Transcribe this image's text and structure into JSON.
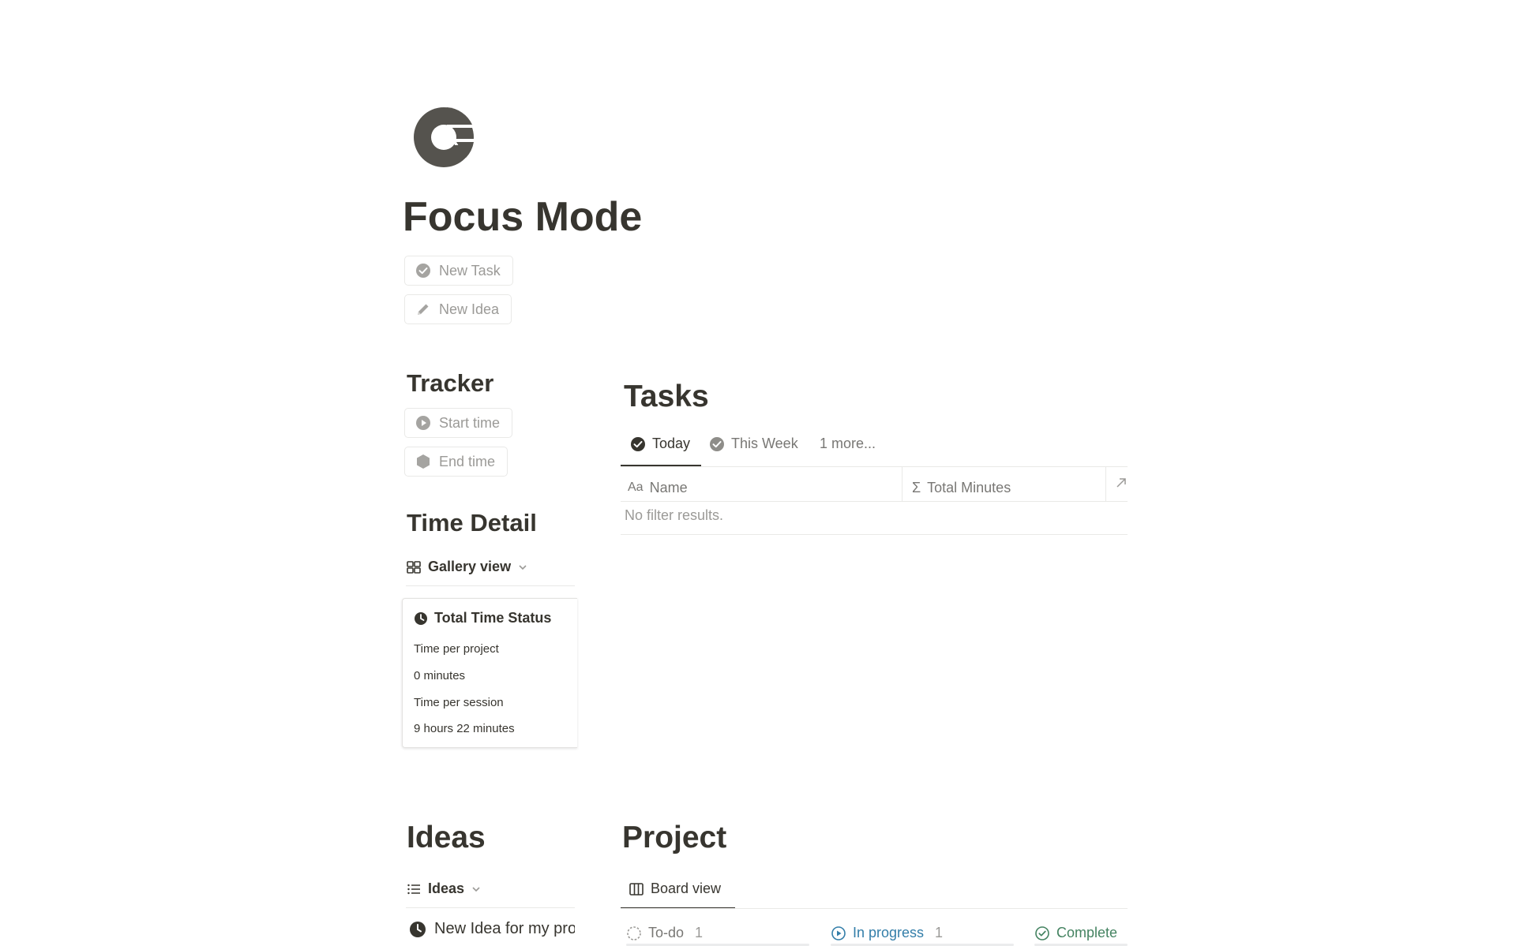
{
  "page": {
    "title": "Focus Mode",
    "icon": "pie-chart-icon"
  },
  "actions": {
    "new_task": {
      "label": "New Task",
      "icon": "check-circle-icon"
    },
    "new_idea": {
      "label": "New Idea",
      "icon": "pencil-icon"
    }
  },
  "tracker": {
    "heading": "Tracker",
    "start": {
      "label": "Start time",
      "icon": "play-circle-icon"
    },
    "end": {
      "label": "End time",
      "icon": "hexagon-stop-icon"
    }
  },
  "time_detail": {
    "heading": "Time Detail",
    "view": {
      "label": "Gallery view",
      "icon": "gallery-grid-icon"
    },
    "card": {
      "title": "Total Time Status",
      "icon": "clock-icon",
      "lines": [
        "Time per project",
        "0 minutes",
        "Time per session",
        "9 hours 22 minutes"
      ]
    }
  },
  "tasks": {
    "heading": "Tasks",
    "tabs": [
      {
        "label": "Today",
        "active": true
      },
      {
        "label": "This Week",
        "active": false
      }
    ],
    "more": "1 more...",
    "columns": [
      {
        "prefix": "Aa",
        "label": "Name"
      },
      {
        "prefix": "Σ",
        "label": "Total Minutes"
      }
    ],
    "empty_text": "No filter results."
  },
  "ideas": {
    "heading": "Ideas",
    "view": {
      "label": "Ideas",
      "icon": "list-icon"
    },
    "items": [
      "New Idea for my project"
    ]
  },
  "project": {
    "heading": "Project",
    "view": {
      "label": "Board view",
      "icon": "board-columns-icon"
    },
    "groups": [
      {
        "label": "To-do",
        "count": "1",
        "color": "#787774"
      },
      {
        "label": "In progress",
        "count": "1",
        "color": "#337ea9"
      },
      {
        "label": "Complete",
        "count": "",
        "color": "#448361"
      }
    ]
  },
  "colors": {
    "text": "#37352f",
    "muted": "#9b9a97",
    "border": "#e9e9e7",
    "blue": "#337ea9",
    "green": "#448361"
  }
}
